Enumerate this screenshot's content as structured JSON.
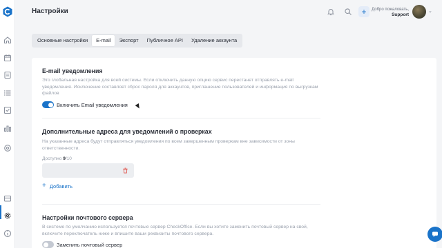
{
  "header": {
    "title": "Настройки",
    "welcome": "Добро пожаловать,",
    "user": "Support"
  },
  "tabs": [
    {
      "label": "Основные настройки",
      "active": false
    },
    {
      "label": "E-mail",
      "active": true
    },
    {
      "label": "Экспорт",
      "active": false
    },
    {
      "label": "Публичное API",
      "active": false
    },
    {
      "label": "Удаление аккаунта",
      "active": false
    }
  ],
  "email_notifications": {
    "title": "E-mail уведомления",
    "description": "Это глобальная настройка для всей системы. Если отключить данную опцию сервис перестанет отправлять e-mail уведомления. Исключение составляет сброс пароля для аккаунтов, приглашение пользователей и информация по выгрузкам файлов",
    "toggle_label": "Включить Email уведомления",
    "enabled": true
  },
  "extra_addresses": {
    "title": "Дополнительные адреса для уведомлений о проверках",
    "description": "На указанные адреса будут отправляться уведомления по всем завершенным проверкам вне зависимости от зоны ответственности.",
    "available_label": "Доступно",
    "used": "9",
    "limit": "/10",
    "add_label": "Добавить"
  },
  "mail_server": {
    "title": "Настройки почтового сервера",
    "description": "В системе по умолчанию используется почтовые сервер CheckOffice. Если вы хотите заменить почтовый сервер на свой, включите переключатель ниже и впишите ваши реквизиты почтового сервера.",
    "toggle_label": "Заменить почтовый сервер",
    "enabled": false
  },
  "colors": {
    "accent": "#1a73c9",
    "danger": "#e0524a",
    "background": "#f4f5f7"
  },
  "icons": {
    "sidebar": [
      "logo-icon",
      "home-icon",
      "calendar-icon",
      "checklist-icon",
      "list-icon",
      "tasks-icon",
      "analytics-icon",
      "objects-icon",
      "archive-icon",
      "settings-icon",
      "help-icon"
    ],
    "header": [
      "bell-icon",
      "search-icon",
      "plus-icon"
    ]
  }
}
